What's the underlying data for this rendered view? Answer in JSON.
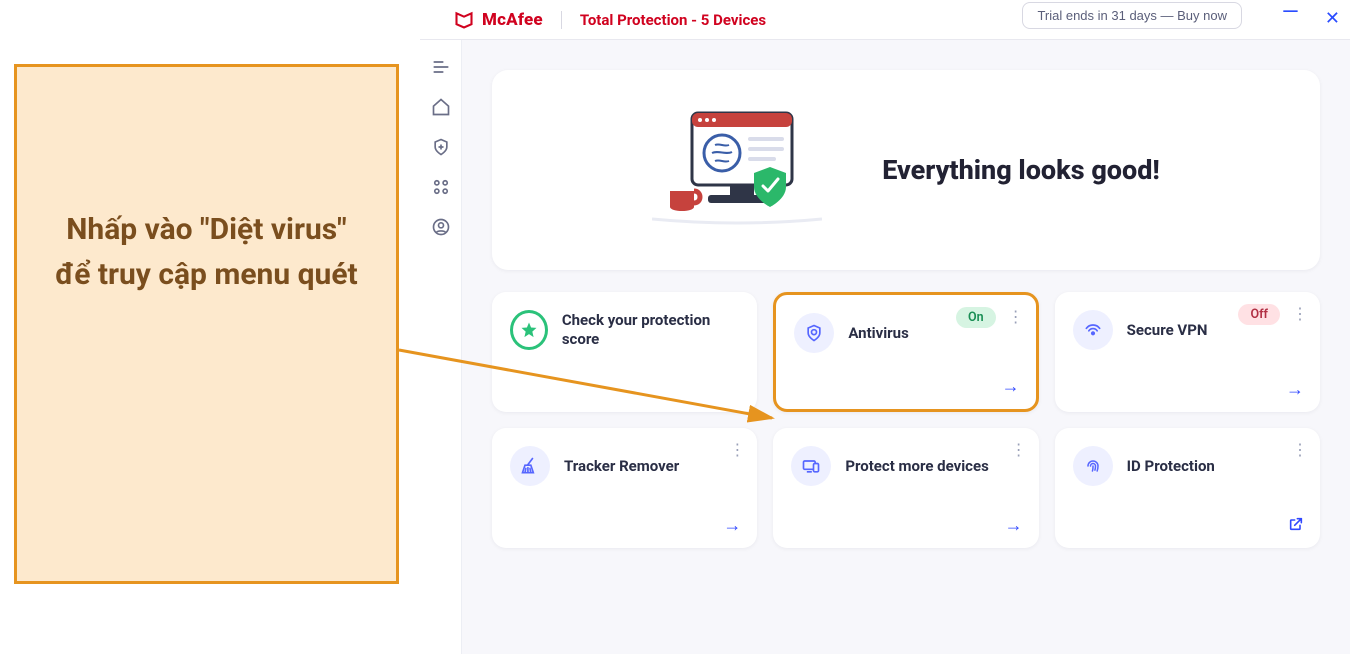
{
  "annotation": {
    "text": "Nhấp vào \"Diệt virus\" để truy cập menu quét"
  },
  "titlebar": {
    "brand": "McAfee",
    "product": "Total Protection - 5 Devices",
    "trial_button": "Trial ends in 31 days — Buy now"
  },
  "hero": {
    "title": "Everything looks good!"
  },
  "badges": {
    "on": "On",
    "off": "Off"
  },
  "cards": {
    "protection_score": "Check your protection score",
    "antivirus": "Antivirus",
    "secure_vpn": "Secure VPN",
    "tracker_remover": "Tracker Remover",
    "protect_more": "Protect more devices",
    "id_protection": "ID Protection"
  },
  "colors": {
    "accent_orange": "#e6941f",
    "callout_bg": "#fde9cd",
    "callout_text": "#7a4e1e",
    "mcafee_red": "#d0021f",
    "link_blue": "#3148ff"
  }
}
